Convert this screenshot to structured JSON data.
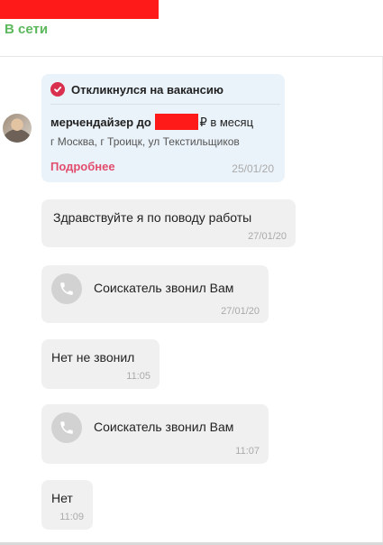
{
  "header": {
    "status": "В сети"
  },
  "vacancy_card": {
    "title": "Откликнулся на вакансию",
    "job_prefix": "мерчендайзер до",
    "job_suffix": "₽ в месяц",
    "address": "г Москва, г Троицк, ул Текстильщиков",
    "more_link": "Подробнее",
    "date": "25/01/20"
  },
  "messages": [
    {
      "text": "Здравствуйте я по поводу работы",
      "time": "27/01/20"
    },
    {
      "text": "Соискатель звонил Вам",
      "time": "27/01/20",
      "icon": "phone-icon"
    },
    {
      "text": "Нет не звонил",
      "time": "11:05"
    },
    {
      "text": "Соискатель звонил Вам",
      "time": "11:07",
      "icon": "phone-icon"
    },
    {
      "text": "Нет",
      "time": "11:09"
    }
  ],
  "colors": {
    "online": "#5cb85c",
    "accent": "#d9304f",
    "link": "#e34d6d",
    "card_bg": "#eaf3fa",
    "bubble_bg": "#f0f0f0",
    "redaction": "#ff1a1a"
  }
}
